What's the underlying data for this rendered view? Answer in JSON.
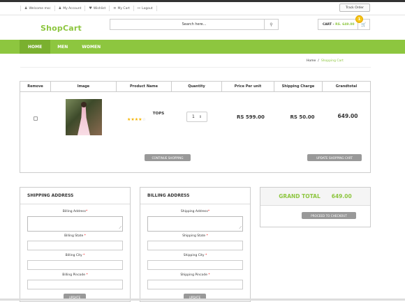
{
  "topbar": {
    "links": [
      {
        "icon": "user-icon",
        "glyph": "♟",
        "label": "Welcome msc"
      },
      {
        "icon": "account-icon",
        "glyph": "♟",
        "label": "My Account"
      },
      {
        "icon": "heart-icon",
        "glyph": "♥",
        "label": "Wishlist"
      },
      {
        "icon": "cart-icon",
        "glyph": "≡",
        "label": "My Cart"
      },
      {
        "icon": "logout-icon",
        "glyph": "↦",
        "label": "Logout"
      }
    ],
    "track_order": "Track Order"
  },
  "header": {
    "logo": "ShopCart",
    "search_placeholder": "Search here...",
    "cart_label": "CART - ",
    "cart_amount": "RS. 649.00",
    "cart_count": "1"
  },
  "nav": {
    "items": [
      "HOME",
      "MEN",
      "WOMEN"
    ],
    "active": "HOME"
  },
  "breadcrumb": {
    "home": "Home",
    "sep": "/",
    "current": "Shopping Cart"
  },
  "cart_table": {
    "headers": [
      "Remove",
      "Image",
      "Product Name",
      "Quantity",
      "Price Per unit",
      "Shipping Charge",
      "Grandtotal"
    ],
    "rows": [
      {
        "product_name": "TOPS",
        "rating": 4,
        "quantity": "1",
        "price": "RS 599.00",
        "shipping": "RS 50.00",
        "grandtotal": "649.00"
      }
    ],
    "continue_label": "CONTINUE SHOPPING",
    "update_label": "UPDATE SHOPPING CART"
  },
  "shipping": {
    "title": "SHIPPING ADDRESS",
    "address_label": "Billing Address",
    "state_label": "Billing State ",
    "city_label": "Billing City ",
    "pincode_label": "Billing Pincode ",
    "update_label": "UPDATE"
  },
  "billing": {
    "title": "BILLING ADDRESS",
    "address_label": "Shipping Address",
    "state_label": "Shipping State ",
    "city_label": "Shipping City ",
    "pincode_label": "Shipping Pincode ",
    "update_label": "UPDATE"
  },
  "grand_total": {
    "label": "GRAND TOTAL",
    "value": "649.00",
    "checkout_label": "PROCEED TO CHECKOUT"
  },
  "colors": {
    "accent": "#8dc63f",
    "badge": "#f5c518",
    "required": "#ee0000"
  }
}
